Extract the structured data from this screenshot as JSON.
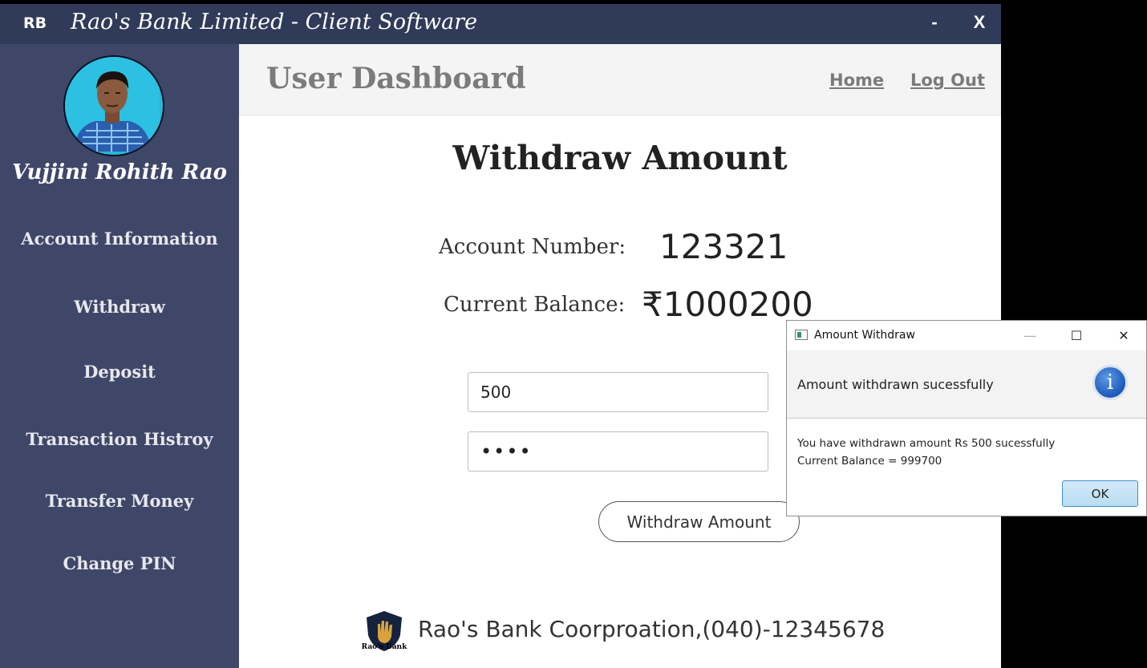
{
  "titlebar": {
    "logo": "RB",
    "title": "Rao's Bank Limited - Client Software",
    "minimize_label": "-",
    "close_label": "X"
  },
  "sidebar": {
    "user_name": "Vujjini Rohith Rao",
    "items": [
      {
        "label": "Account Information"
      },
      {
        "label": "Withdraw"
      },
      {
        "label": "Deposit"
      },
      {
        "label": "Transaction Histroy"
      },
      {
        "label": "Transfer Money"
      },
      {
        "label": "Change PIN"
      }
    ]
  },
  "header": {
    "title": "User Dashboard",
    "home_label": "Home",
    "logout_label": "Log Out"
  },
  "main": {
    "heading": "Withdraw Amount",
    "account_number_label": "Account Number:",
    "account_number_value": "123321",
    "current_balance_label": "Current Balance:",
    "current_balance_value": "₹1000200",
    "amount_value": "500",
    "pin_value": "1234",
    "withdraw_button_label": "Withdraw Amount"
  },
  "footer": {
    "logo_text": "Rao's Bank",
    "text": "Rao's Bank Coorproation,(040)-12345678"
  },
  "dialog": {
    "title": "Amount Withdraw",
    "header_text": "Amount withdrawn sucessfully",
    "icon_glyph": "i",
    "line1": "You have withdrawn amount Rs 500 sucessfully",
    "line2": "Current Balance = 999700",
    "ok_label": "OK",
    "minimize_glyph": "—",
    "maximize_glyph": "☐",
    "close_glyph": "✕"
  },
  "colors": {
    "titlebar": "#303a59",
    "sidebar": "#3f4769",
    "accent": "#1c58b8"
  }
}
